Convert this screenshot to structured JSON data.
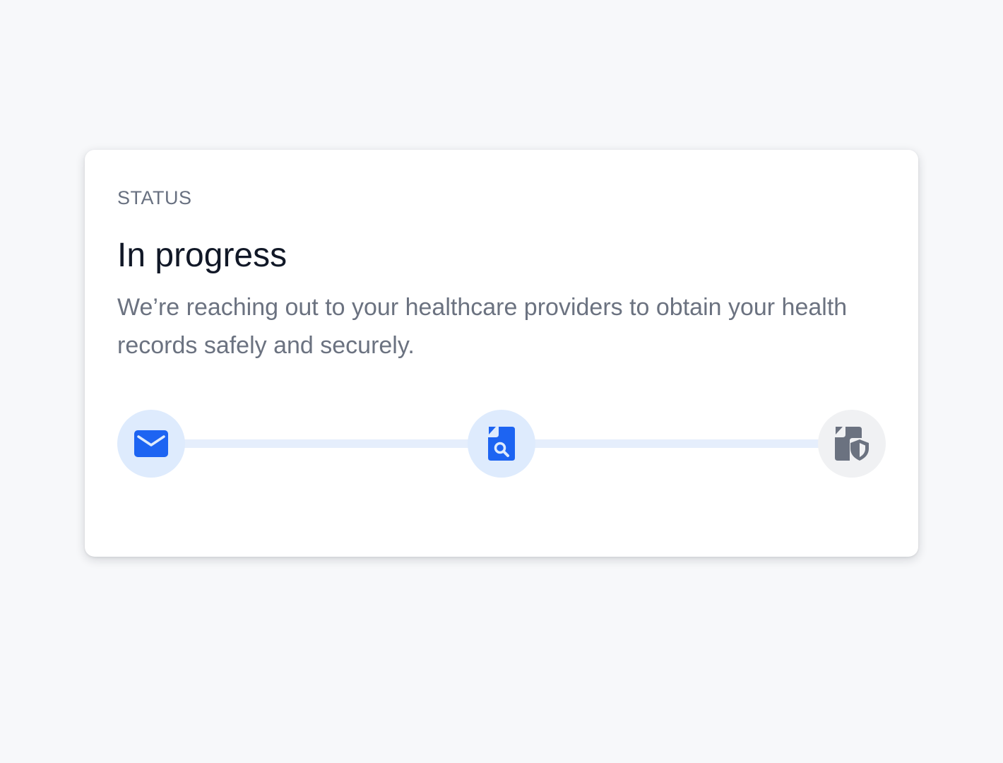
{
  "status_card": {
    "eyebrow": "STATUS",
    "title": "In progress",
    "description": "We’re reaching out to your healthcare providers to obtain your health records safely and securely."
  },
  "stepper": {
    "steps": [
      {
        "icon": "envelope-icon",
        "state": "active"
      },
      {
        "icon": "document-search-icon",
        "state": "active"
      },
      {
        "icon": "document-shield-icon",
        "state": "pending"
      }
    ]
  },
  "colors": {
    "accent": "#1d64f2",
    "active_step_bg": "#deebfd",
    "pending_step_bg": "#f0f1f3",
    "pending_icon": "#6b7280",
    "connector": "#e5eefc",
    "title_text": "#111827",
    "muted_text": "#6b7280",
    "page_background": "#f7f8fa"
  }
}
